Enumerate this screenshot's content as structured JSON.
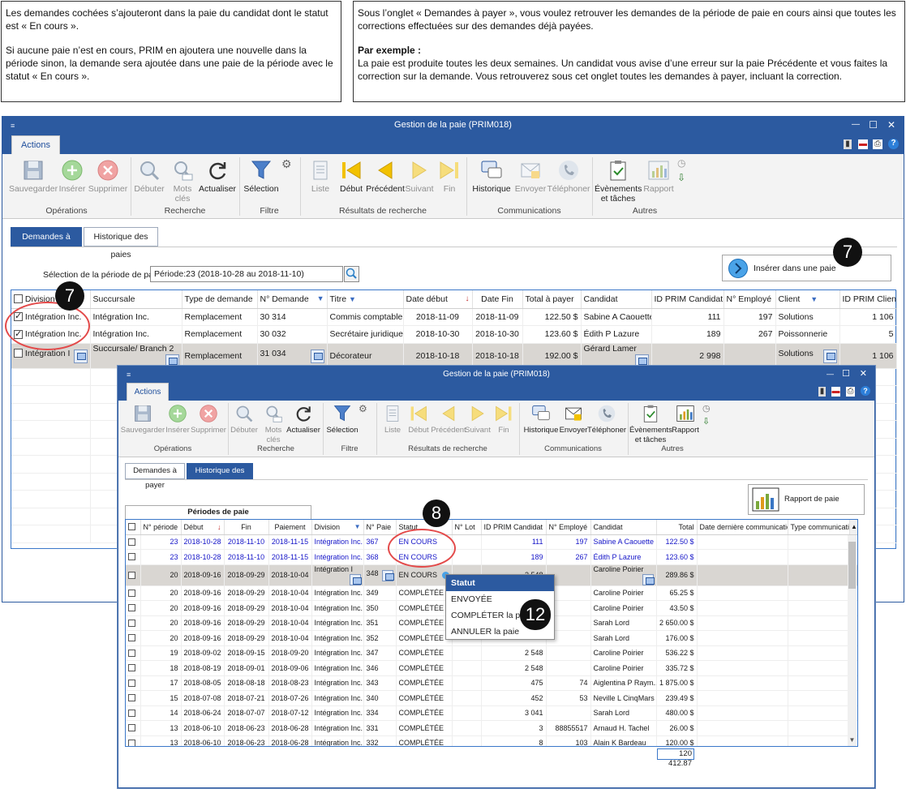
{
  "notes": {
    "left": [
      "Les demandes cochées s’ajouteront dans la paie du candidat dont le statut est « En cours ».",
      "Si aucune paie n’est en cours, PRIM en ajoutera une nouvelle dans la période sinon, la demande sera ajoutée dans une paie de la période avec le statut « En cours »."
    ],
    "right_intro": "Sous l’onglet « Demandes à payer », vous voulez retrouver les demandes de la période de paie en cours ainsi que toutes les corrections effectuées sur des demandes déjà payées.",
    "right_example_title": "Par exemple :",
    "right_example": "La paie est produite toutes les deux semaines. Un candidat vous avise d’une erreur sur la paie Précédente et vous faites la correction sur la demande. Vous retrouverez sous cet onglet toutes les demandes à payer, incluant la correction."
  },
  "window": {
    "title": "Gestion de la paie (PRIM018)",
    "actions_tab": "Actions",
    "minimize": "—",
    "maximize": "☐",
    "close": "✕",
    "menu_glyph": "≡",
    "tools": [
      "▮",
      "▬",
      "⎙",
      "?"
    ]
  },
  "ribbon": {
    "save": "Sauvegarder",
    "insert": "Insérer",
    "delete": "Supprimer",
    "start": "Débuter",
    "keywords": [
      "Mots",
      "clés"
    ],
    "refresh": "Actualiser",
    "selection": "Sélection",
    "list": "Liste",
    "first": "Début",
    "prev": "Précédent",
    "next": "Suivant",
    "last": "Fin",
    "history": "Historique",
    "send": "Envoyer",
    "phone": "Téléphoner",
    "events": [
      "Évènements",
      "et tâches"
    ],
    "report": "Rapport",
    "groups": {
      "operations": "Opérations",
      "search": "Recherche",
      "filter": "Filtre",
      "results": "Résultats de recherche",
      "communications": "Communications",
      "others": "Autres"
    }
  },
  "win1": {
    "tabs": {
      "to_pay": "Demandes à payer",
      "history": "Historique des paies"
    },
    "period_label": "Sélection de la période de paie",
    "period_value": "Période:23 (2018-10-28 au 2018-11-10)",
    "insert_button": "Insérer dans une paie",
    "columns": [
      "Division",
      "Succursale",
      "Type de demande",
      "N° Demande",
      "Titre",
      "Date début",
      "Date Fin",
      "Total à payer",
      "Candidat",
      "ID PRIM Candidat",
      "N° Employé",
      "Client",
      "ID PRIM Client"
    ],
    "rows": [
      [
        "Intégration Inc.",
        "Intégration Inc.",
        "Remplacement",
        "30 314",
        "Commis comptable",
        "2018-11-09",
        "2018-11-09",
        "122.50 $",
        "Sabine A Caouette",
        "111",
        "197",
        "Solutions",
        "1 106"
      ],
      [
        "Intégration Inc.",
        "Intégration Inc.",
        "Remplacement",
        "30 032",
        "Secrétaire juridique",
        "2018-10-30",
        "2018-10-30",
        "123.60 $",
        "Édith P Lazure",
        "189",
        "267",
        "Poissonnerie",
        "5"
      ],
      [
        "Intégration I",
        "Succursale/ Branch 2",
        "Remplacement",
        "31 034",
        "Décorateur",
        "2018-10-18",
        "2018-10-18",
        "192.00 $",
        "Gérard Lamer",
        "2 998",
        "",
        "Solutions",
        "1 106"
      ]
    ]
  },
  "win2": {
    "tabs": {
      "to_pay": "Demandes à payer",
      "history": "Historique des paies"
    },
    "report_button": "Rapport de paie",
    "periods_header": "Périodes de paie",
    "columns": [
      "N° période",
      "Début",
      "Fin",
      "Paiement",
      "Division",
      "N° Paie",
      "Statut",
      "N° Lot",
      "ID PRIM Candidat",
      "N° Employé",
      "Candidat",
      "Total",
      "Date dernière communication",
      "Type communication"
    ],
    "rows": [
      [
        "23",
        "2018-10-28",
        "2018-11-10",
        "2018-11-15",
        "Intégration Inc.",
        "367",
        "EN COURS",
        "",
        "111",
        "197",
        "Sabine A Caouette",
        "122.50 $",
        "",
        ""
      ],
      [
        "23",
        "2018-10-28",
        "2018-11-10",
        "2018-11-15",
        "Intégration Inc.",
        "368",
        "EN COURS",
        "",
        "189",
        "267",
        "Édith P Lazure",
        "123.60 $",
        "",
        ""
      ],
      [
        "20",
        "2018-09-16",
        "2018-09-29",
        "2018-10-04",
        "Intégration I",
        "348",
        "EN COURS",
        "",
        "2 548",
        "",
        "Caroline Poirier",
        "289.86 $",
        "",
        ""
      ],
      [
        "20",
        "2018-09-16",
        "2018-09-29",
        "2018-10-04",
        "Intégration Inc.",
        "349",
        "COMPLÉTÉE",
        "",
        "",
        "",
        "Caroline Poirier",
        "65.25 $",
        "",
        ""
      ],
      [
        "20",
        "2018-09-16",
        "2018-09-29",
        "2018-10-04",
        "Intégration Inc.",
        "350",
        "COMPLÉTÉE",
        "",
        "",
        "",
        "Caroline Poirier",
        "43.50 $",
        "",
        ""
      ],
      [
        "20",
        "2018-09-16",
        "2018-09-29",
        "2018-10-04",
        "Intégration Inc.",
        "351",
        "COMPLÉTÉE",
        "",
        "",
        "",
        "Sarah Lord",
        "2 650.00 $",
        "",
        ""
      ],
      [
        "20",
        "2018-09-16",
        "2018-09-29",
        "2018-10-04",
        "Intégration Inc.",
        "352",
        "COMPLÉTÉE",
        "",
        "",
        "",
        "Sarah Lord",
        "176.00 $",
        "",
        ""
      ],
      [
        "19",
        "2018-09-02",
        "2018-09-15",
        "2018-09-20",
        "Intégration Inc.",
        "347",
        "COMPLÉTÉE",
        "",
        "2 548",
        "",
        "Caroline Poirier",
        "536.22 $",
        "",
        ""
      ],
      [
        "18",
        "2018-08-19",
        "2018-09-01",
        "2018-09-06",
        "Intégration Inc.",
        "346",
        "COMPLÉTÉE",
        "",
        "2 548",
        "",
        "Caroline Poirier",
        "335.72 $",
        "",
        ""
      ],
      [
        "17",
        "2018-08-05",
        "2018-08-18",
        "2018-08-23",
        "Intégration Inc.",
        "343",
        "COMPLÉTÉE",
        "",
        "475",
        "74",
        "Aiglentina P Raym...",
        "1 875.00 $",
        "",
        ""
      ],
      [
        "15",
        "2018-07-08",
        "2018-07-21",
        "2018-07-26",
        "Intégration Inc.",
        "340",
        "COMPLÉTÉE",
        "",
        "452",
        "53",
        "Neville L CinqMars",
        "239.49 $",
        "",
        ""
      ],
      [
        "14",
        "2018-06-24",
        "2018-07-07",
        "2018-07-12",
        "Intégration Inc.",
        "334",
        "COMPLÉTÉE",
        "",
        "3 041",
        "",
        "Sarah Lord",
        "480.00 $",
        "",
        ""
      ],
      [
        "13",
        "2018-06-10",
        "2018-06-23",
        "2018-06-28",
        "Intégration Inc.",
        "331",
        "COMPLÉTÉE",
        "",
        "3",
        "88855517",
        "Arnaud H. Tachel",
        "26.00 $",
        "",
        ""
      ],
      [
        "13",
        "2018-06-10",
        "2018-06-23",
        "2018-06-28",
        "Intégration Inc.",
        "332",
        "COMPLÉTÉE",
        "",
        "8",
        "103",
        "Alain K Bardeau",
        "120.00 $",
        "",
        ""
      ]
    ],
    "total": "120 412.87",
    "status_menu": {
      "header": "Statut",
      "items": [
        "ENVOYÉE",
        "COMPLÉTER la paie",
        "ANNULER la paie"
      ]
    }
  },
  "callouts": {
    "seven_a": "7",
    "seven_b": "7",
    "eight": "8",
    "twelve": "12"
  },
  "colors": {
    "accent": "#2c5aa0",
    "link": "#1515c8",
    "annotation": "#e34a4a"
  }
}
